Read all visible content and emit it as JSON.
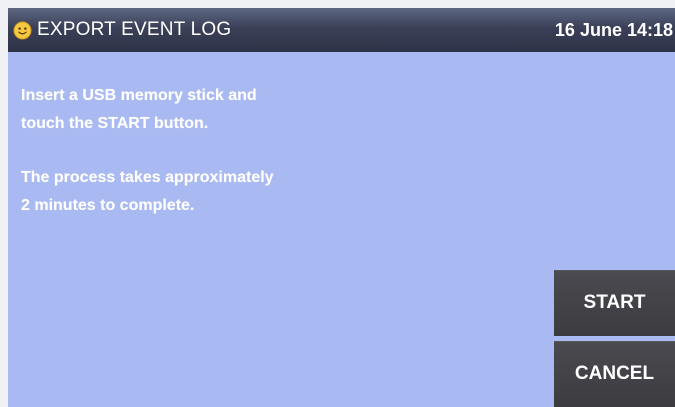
{
  "header": {
    "icon": "smiley-icon",
    "title": "EXPORT EVENT LOG",
    "datetime": "16 June 14:18"
  },
  "body": {
    "line1": "Insert a USB memory stick and",
    "line2": "touch the START button.",
    "line3": "The process takes approximately",
    "line4": "2 minutes to complete."
  },
  "buttons": {
    "start_label": "START",
    "cancel_label": "CANCEL"
  },
  "colors": {
    "background": "#a9b9f1",
    "title_bar": "#3a4057",
    "button": "#434348",
    "icon": "#f5c842",
    "text": "#ffffff"
  }
}
